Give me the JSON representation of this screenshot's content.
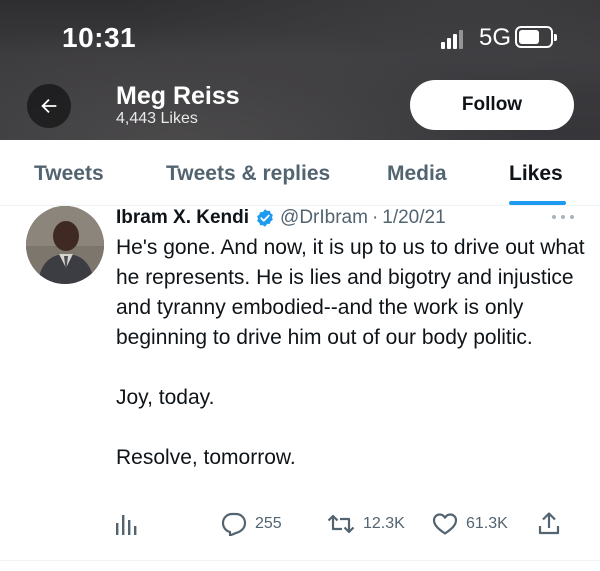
{
  "status_bar": {
    "time": "10:31",
    "network": "5G"
  },
  "profile": {
    "name": "Meg Reiss",
    "likes_count": "4,443 Likes",
    "follow_label": "Follow"
  },
  "tabs": [
    {
      "label": "Tweets",
      "active": false
    },
    {
      "label": "Tweets & replies",
      "active": false
    },
    {
      "label": "Media",
      "active": false
    },
    {
      "label": "Likes",
      "active": true
    }
  ],
  "tweet": {
    "author_name": "Ibram X. Kendi",
    "handle": "@DrIbram",
    "separator": "·",
    "date": "1/20/21",
    "paragraphs": [
      "He's gone. And now, it is up to us to drive out what he represents. He is lies and bigotry and injustice and tyranny embodied--and the work is only beginning to drive him out of our body politic.",
      "Joy, today.",
      "Resolve, tomorrow."
    ],
    "replies": "255",
    "retweets": "12.3K",
    "likes": "61.3K"
  },
  "icons": {
    "back": "arrow-left-icon",
    "verified": "verified-badge-icon",
    "more": "more-dots-icon",
    "analytics": "analytics-icon",
    "reply": "reply-icon",
    "retweet": "retweet-icon",
    "like": "heart-icon",
    "share": "share-icon"
  },
  "colors": {
    "accent": "#1d9bf0",
    "text_primary": "#0f1419",
    "text_secondary": "#536471",
    "header_bg": "#36363a"
  }
}
